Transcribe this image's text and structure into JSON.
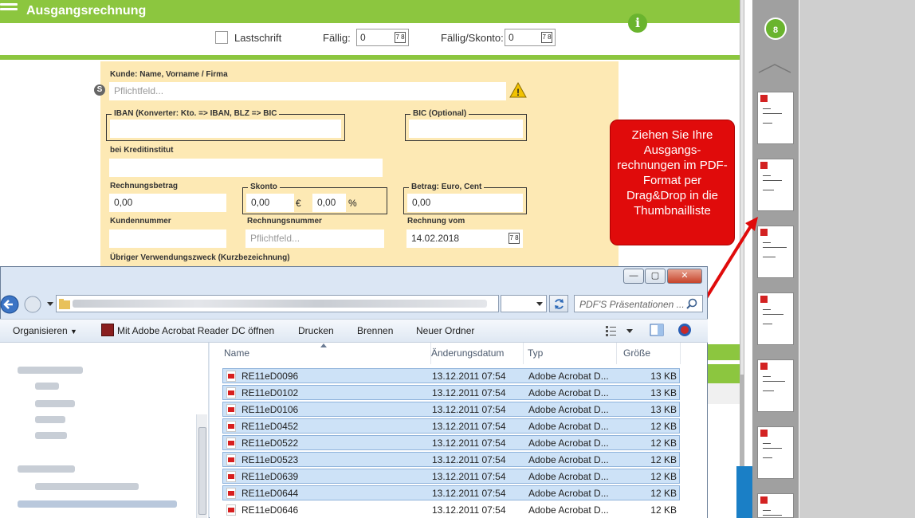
{
  "app": {
    "title": "Ausgangsrechnung"
  },
  "header": {
    "lastschrift_label": "Lastschrift",
    "faellig_label": "Fällig:",
    "faellig_value": "0",
    "faellig_skonto_label": "Fällig/Skonto:",
    "faellig_skonto_value": "0",
    "calendar_glyph": "7 8",
    "info_glyph": "i"
  },
  "form": {
    "kunde_label": "Kunde: Name, Vorname / Firma",
    "kunde_placeholder": "Pflichtfeld...",
    "kunde_prefix_icon": "S",
    "warning_glyph": "!",
    "iban_label": "IBAN (Konverter: Kto. => IBAN, BLZ => BIC",
    "bic_label": "BIC (Optional)",
    "kreditinstitut_label": "bei Kreditinstitut",
    "rechnungsbetrag_label": "Rechnungsbetrag",
    "rechnungsbetrag_value": "0,00",
    "skonto_label": "Skonto",
    "skonto_eur_value": "0,00",
    "skonto_eur_unit": "€",
    "skonto_pct_value": "0,00",
    "skonto_pct_unit": "%",
    "betrag_label": "Betrag: Euro, Cent",
    "betrag_value": "0,00",
    "kundennummer_label": "Kundennummer",
    "rechnungsnummer_label": "Rechnungsnummer",
    "rechnungsnummer_placeholder": "Pflichtfeld...",
    "rechnung_vom_label": "Rechnung vom",
    "rechnung_vom_value": "14.02.2018",
    "verwendungszweck_label": "Übriger Verwendungszweck (Kurzbezeichnung)"
  },
  "sidebar": {
    "count_badge": "8"
  },
  "tooltip": {
    "text": "Ziehen Sie Ihre Ausgangs-rechnungen im PDF-Format per Drag&Drop in die Thumbnailliste"
  },
  "explorer": {
    "window_buttons": {
      "minimize": "—",
      "maximize": "▢",
      "close": "✕"
    },
    "search_placeholder": "PDF'S Präsentationen ...",
    "toolbar": {
      "organize": "Organisieren",
      "open_with": "Mit Adobe Acrobat Reader DC öffnen",
      "print": "Drucken",
      "burn": "Brennen",
      "new_folder": "Neuer Ordner"
    },
    "columns": {
      "name": "Name",
      "date": "Änderungsdatum",
      "type": "Typ",
      "size": "Größe"
    },
    "files": [
      {
        "name": "RE11eD0096",
        "date": "13.12.2011 07:54",
        "type": "Adobe Acrobat D...",
        "size": "13 KB"
      },
      {
        "name": "RE11eD0102",
        "date": "13.12.2011 07:54",
        "type": "Adobe Acrobat D...",
        "size": "13 KB"
      },
      {
        "name": "RE11eD0106",
        "date": "13.12.2011 07:54",
        "type": "Adobe Acrobat D...",
        "size": "13 KB"
      },
      {
        "name": "RE11eD0452",
        "date": "13.12.2011 07:54",
        "type": "Adobe Acrobat D...",
        "size": "12 KB"
      },
      {
        "name": "RE11eD0522",
        "date": "13.12.2011 07:54",
        "type": "Adobe Acrobat D...",
        "size": "12 KB"
      },
      {
        "name": "RE11eD0523",
        "date": "13.12.2011 07:54",
        "type": "Adobe Acrobat D...",
        "size": "12 KB"
      },
      {
        "name": "RE11eD0639",
        "date": "13.12.2011 07:54",
        "type": "Adobe Acrobat D...",
        "size": "12 KB"
      },
      {
        "name": "RE11eD0644",
        "date": "13.12.2011 07:54",
        "type": "Adobe Acrobat D...",
        "size": "12 KB"
      },
      {
        "name": "RE11eD0646",
        "date": "13.12.2011 07:54",
        "type": "Adobe Acrobat D...",
        "size": "12 KB"
      }
    ]
  },
  "colors": {
    "brand_green": "#8cc63f",
    "tooltip_red": "#e00b0b",
    "selection_blue": "#cde2f7"
  }
}
